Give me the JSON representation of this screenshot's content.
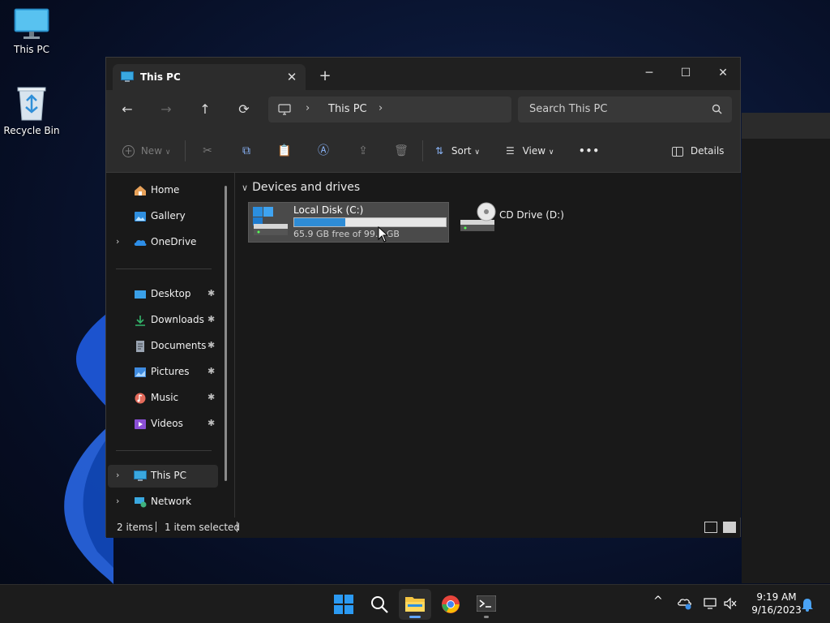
{
  "desktop": {
    "icons": [
      {
        "label": "This PC"
      },
      {
        "label": "Recycle Bin"
      }
    ]
  },
  "explorer": {
    "tab": {
      "title": "This PC",
      "close": "✕",
      "new": "+"
    },
    "window_controls": {
      "minimize": "─",
      "maximize": "☐",
      "close": "✕"
    },
    "nav_buttons": {
      "back": "←",
      "forward": "→",
      "up": "↑",
      "refresh": "⟳"
    },
    "address": {
      "chevron": "›",
      "path": "This PC"
    },
    "search": {
      "placeholder": "Search This PC"
    },
    "commands": {
      "new": "New",
      "sort": "Sort",
      "view": "View",
      "more": "•••",
      "details": "Details"
    },
    "nav_pane": {
      "top": [
        {
          "label": "Home",
          "icon": "home-icon"
        },
        {
          "label": "Gallery",
          "icon": "gallery-icon"
        },
        {
          "label": "OneDrive",
          "icon": "cloud-icon",
          "expander": "›"
        }
      ],
      "quick_access": [
        {
          "label": "Desktop",
          "icon": "desktop-folder-icon",
          "color": "#3aa0e8"
        },
        {
          "label": "Downloads",
          "icon": "download-icon",
          "color": "#33b56a"
        },
        {
          "label": "Documents",
          "icon": "documents-icon",
          "color": "#9aa4b2"
        },
        {
          "label": "Pictures",
          "icon": "pictures-icon",
          "color": "#3f8be0"
        },
        {
          "label": "Music",
          "icon": "music-icon",
          "color": "#e46b5b"
        },
        {
          "label": "Videos",
          "icon": "videos-icon",
          "color": "#8a4fd6"
        }
      ],
      "pin": "📌",
      "bottom": [
        {
          "label": "This PC",
          "icon": "this-pc-icon",
          "expander": "›",
          "selected": true
        },
        {
          "label": "Network",
          "icon": "network-icon",
          "expander": "›"
        }
      ]
    },
    "content": {
      "group_caret": "∨",
      "group_title": "Devices and drives",
      "drives": [
        {
          "name": "Local Disk (C:)",
          "free_text": "65.9 GB free of 99.3 GB",
          "used_fraction": 0.336,
          "selected": true
        },
        {
          "name": "CD Drive (D:)"
        }
      ]
    },
    "status": {
      "items": "2 items",
      "selection": "1 item selected"
    }
  },
  "taskbar": {
    "apps": [
      "start-icon",
      "search-icon",
      "file-explorer-icon",
      "chrome-icon",
      "terminal-icon"
    ],
    "tray_chevron": "^",
    "time": "9:19 AM",
    "date": "9/16/2023"
  },
  "colors": {
    "accent": "#60a5fa",
    "drive_fill": "#2e8cd6",
    "window_bg": "#191919",
    "chrome_bg": "#2c2c2c"
  }
}
